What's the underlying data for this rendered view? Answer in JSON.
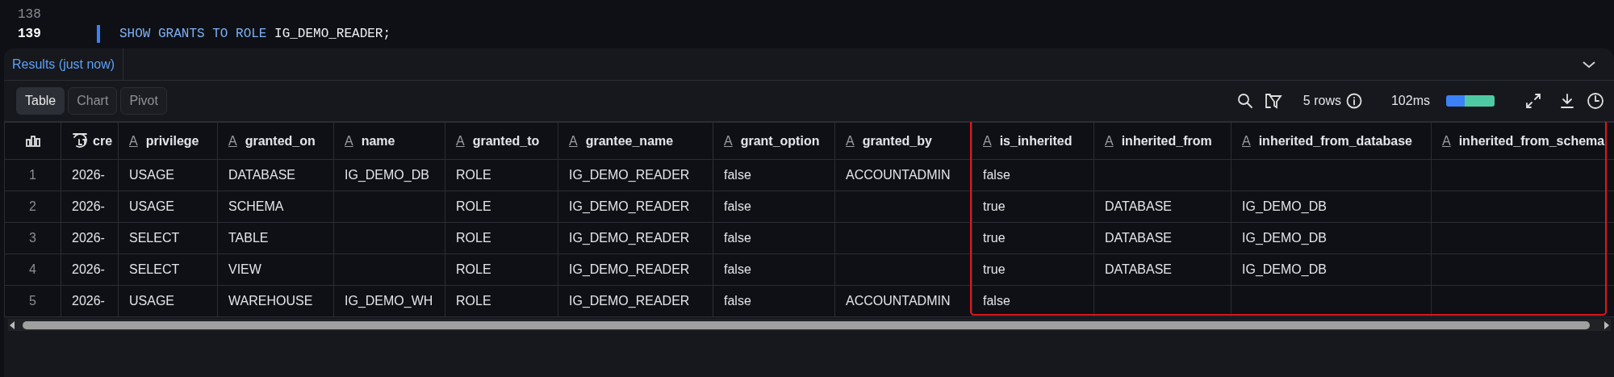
{
  "editor": {
    "lines": [
      {
        "number": "138",
        "active": false
      },
      {
        "number": "139",
        "active": true,
        "tokens": [
          {
            "kind": "keyword",
            "text": "SHOW GRANTS TO ROLE"
          },
          {
            "kind": "identifier",
            "text": "IG_DEMO_READER;"
          }
        ]
      }
    ]
  },
  "results": {
    "tabs": [
      {
        "label": "Results (just now)",
        "selected": true
      }
    ],
    "views": [
      {
        "label": "Table",
        "selected": true
      },
      {
        "label": "Chart",
        "selected": false
      },
      {
        "label": "Pivot",
        "selected": false
      }
    ],
    "row_count": "5 rows",
    "duration": "102ms",
    "table": {
      "columns": [
        {
          "kind": "timestamp",
          "label": "cre",
          "highlighted": false
        },
        {
          "kind": "text",
          "type_glyph": "A",
          "label": "privilege",
          "highlighted": false
        },
        {
          "kind": "text",
          "type_glyph": "A",
          "label": "granted_on",
          "highlighted": false
        },
        {
          "kind": "text",
          "type_glyph": "A",
          "label": "name",
          "highlighted": false
        },
        {
          "kind": "text",
          "type_glyph": "A",
          "label": "granted_to",
          "highlighted": false
        },
        {
          "kind": "text",
          "type_glyph": "A",
          "label": "grantee_name",
          "highlighted": false
        },
        {
          "kind": "text",
          "type_glyph": "A",
          "label": "grant_option",
          "highlighted": false
        },
        {
          "kind": "text",
          "type_glyph": "A",
          "label": "granted_by",
          "highlighted": false
        },
        {
          "kind": "text",
          "type_glyph": "A",
          "label": "is_inherited",
          "highlighted": true
        },
        {
          "kind": "text",
          "type_glyph": "A",
          "label": "inherited_from",
          "highlighted": true
        },
        {
          "kind": "text",
          "type_glyph": "A",
          "label": "inherited_from_database",
          "highlighted": true
        },
        {
          "kind": "text",
          "type_glyph": "A",
          "label": "inherited_from_schema",
          "highlighted": true
        }
      ],
      "rows": [
        {
          "number": "1",
          "cells": [
            "2026-",
            "USAGE",
            "DATABASE",
            "IG_DEMO_DB",
            "ROLE",
            "IG_DEMO_READER",
            "false",
            "ACCOUNTADMIN",
            "false",
            "",
            "",
            ""
          ]
        },
        {
          "number": "2",
          "cells": [
            "2026-",
            "USAGE",
            "SCHEMA",
            "",
            "ROLE",
            "IG_DEMO_READER",
            "false",
            "",
            "true",
            "DATABASE",
            "IG_DEMO_DB",
            ""
          ]
        },
        {
          "number": "3",
          "cells": [
            "2026-",
            "SELECT",
            "TABLE",
            "",
            "ROLE",
            "IG_DEMO_READER",
            "false",
            "",
            "true",
            "DATABASE",
            "IG_DEMO_DB",
            ""
          ]
        },
        {
          "number": "4",
          "cells": [
            "2026-",
            "SELECT",
            "VIEW",
            "",
            "ROLE",
            "IG_DEMO_READER",
            "false",
            "",
            "true",
            "DATABASE",
            "IG_DEMO_DB",
            ""
          ]
        },
        {
          "number": "5",
          "cells": [
            "2026-",
            "USAGE",
            "WAREHOUSE",
            "IG_DEMO_WH",
            "ROLE",
            "IG_DEMO_READER",
            "false",
            "ACCOUNTADMIN",
            "false",
            "",
            "",
            ""
          ]
        }
      ]
    }
  }
}
